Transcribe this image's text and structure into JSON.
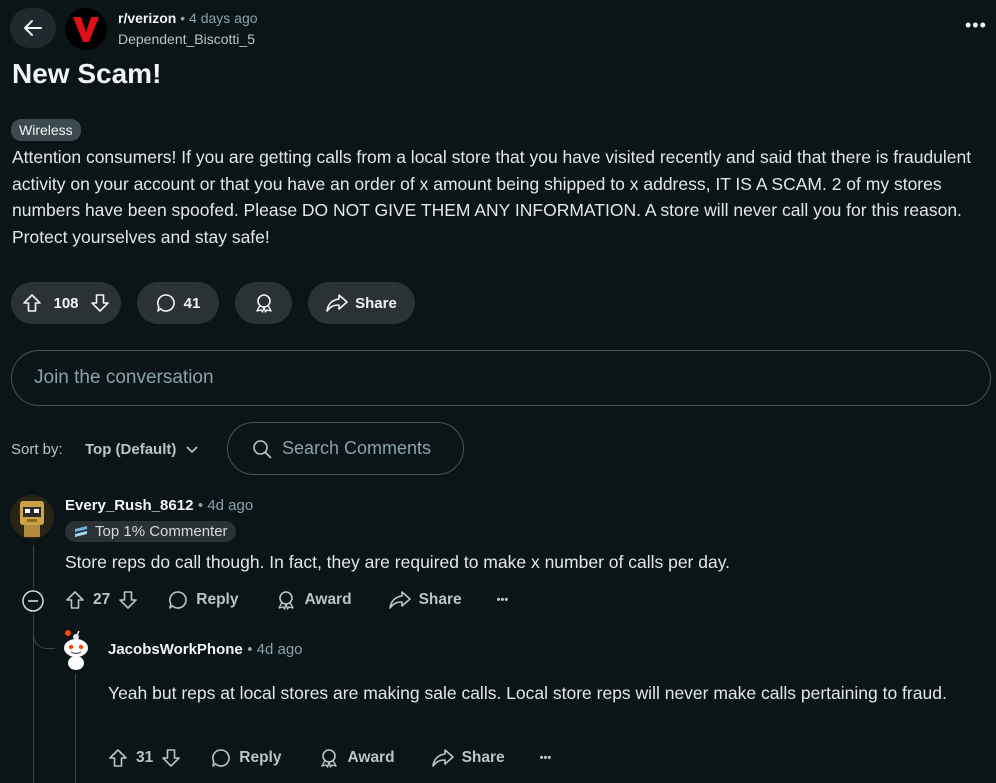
{
  "header": {
    "subreddit": "r/verizon",
    "separator": "•",
    "post_time": "4 days ago",
    "author": "Dependent_Biscotti_5",
    "more": "•••"
  },
  "post": {
    "title": "New Scam!",
    "flair": "Wireless",
    "body": "Attention consumers! If you are getting calls from a local store that you have visited recently and said that there is fraudulent activity on your account or that you have an order of x amount being shipped to x address, IT IS A SCAM. 2 of my stores numbers have been spoofed. Please DO NOT GIVE THEM ANY INFORMATION. A store will never call you for this reason. Protect yourselves and stay safe!",
    "votes": "108",
    "comments": "41",
    "share_label": "Share"
  },
  "join": {
    "placeholder": "Join the conversation"
  },
  "sort": {
    "label": "Sort by:",
    "value": "Top (Default)"
  },
  "search": {
    "placeholder": "Search Comments"
  },
  "comments": [
    {
      "user": "Every_Rush_8612",
      "time": "4d ago",
      "badge": "Top 1% Commenter",
      "text": "Store reps do call though. In fact, they are required to make x number of calls per day.",
      "votes": "27",
      "reply": "Reply",
      "award": "Award",
      "share": "Share",
      "more": "•••"
    },
    {
      "user": "JacobsWorkPhone",
      "time": "4d ago",
      "text": "Yeah but reps at local stores are making sale calls. Local store reps will never make calls pertaining to fraud.",
      "votes": "31",
      "reply": "Reply",
      "award": "Award",
      "share": "Share",
      "more": "•••"
    }
  ],
  "colors": {
    "background": "#0b1416",
    "pill": "#2a3236",
    "verizon_red": "#e0101b"
  }
}
